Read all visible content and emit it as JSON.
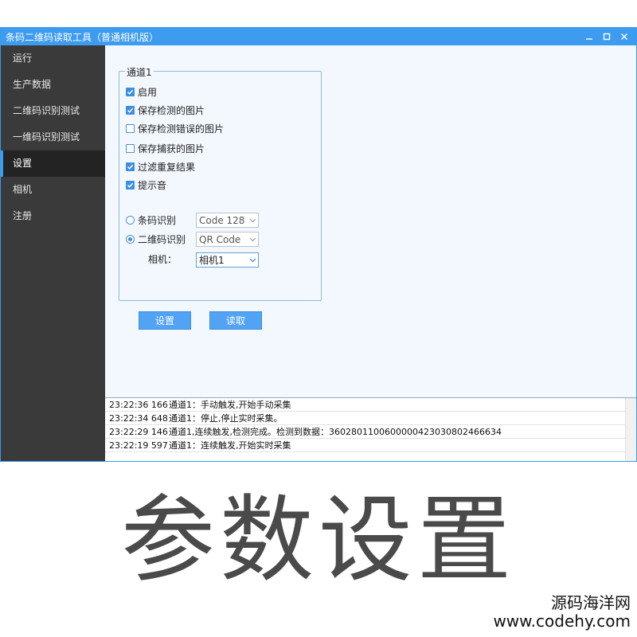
{
  "window": {
    "title": "条码二维码读取工具（普通相机版）",
    "controls": {
      "minimize": "minimize-icon",
      "maximize": "maximize-icon",
      "close": "close-icon"
    }
  },
  "sidebar": {
    "items": [
      {
        "label": "运行",
        "active": false
      },
      {
        "label": "生产数据",
        "active": false
      },
      {
        "label": "二维码识别测试",
        "active": false
      },
      {
        "label": "一维码识别测试",
        "active": false
      },
      {
        "label": "设置",
        "active": true
      },
      {
        "label": "相机",
        "active": false
      },
      {
        "label": "注册",
        "active": false
      }
    ]
  },
  "settings": {
    "group_title": "通道1",
    "checkboxes": [
      {
        "label": "启用",
        "checked": true
      },
      {
        "label": "保存检测的图片",
        "checked": true
      },
      {
        "label": "保存检测错误的图片",
        "checked": false
      },
      {
        "label": "保存捕获的图片",
        "checked": false
      },
      {
        "label": "过滤重复结果",
        "checked": true
      },
      {
        "label": "提示音",
        "checked": true
      }
    ],
    "radios": [
      {
        "label": "条码识别",
        "selected": false,
        "combo_value": "Code 128"
      },
      {
        "label": "二维码识别",
        "selected": true,
        "combo_value": "QR Code"
      }
    ],
    "camera": {
      "label": "相机：",
      "value": "相机1"
    },
    "buttons": {
      "set": "设置",
      "read": "读取"
    }
  },
  "log": [
    {
      "time": "23:22:36 166",
      "message": "通道1：手动触发,开始手动采集"
    },
    {
      "time": "23:22:34 648",
      "message": "通道1：停止,停止实时采集。"
    },
    {
      "time": "23:22:29 146",
      "message": "通道1,连续触发,检测完成。检测到数据：3602801100600000423030802466634"
    },
    {
      "time": "23:22:19 597",
      "message": "通道1：连续触发,开始实时采集"
    }
  ],
  "caption": "参数设置",
  "watermark": {
    "line1": "源码海洋网",
    "line2": "www.codehy.com"
  },
  "colors": {
    "accent": "#3d9cf0",
    "sidebar": "#3a3a3a",
    "sidebar_active": "#232323",
    "content_bg": "#f3f8ff"
  }
}
